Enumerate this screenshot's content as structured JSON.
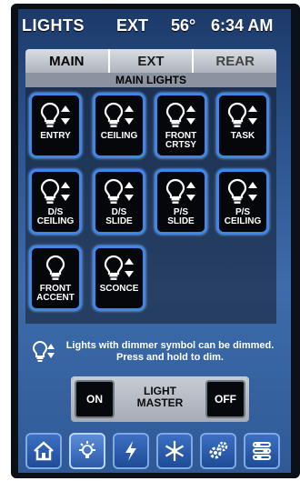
{
  "status": {
    "title": "LIGHTS",
    "ext": "EXT",
    "temp": "56°",
    "time": "6:34 AM"
  },
  "tabs": [
    "MAIN",
    "EXT",
    "REAR"
  ],
  "section_title": "MAIN LIGHTS",
  "lights": [
    {
      "label": "ENTRY",
      "icon": "dimmable-bulb-icon"
    },
    {
      "label": "CEILING",
      "icon": "dimmable-bulb-icon"
    },
    {
      "label": "FRONT\nCRTSY",
      "icon": "dimmable-bulb-icon"
    },
    {
      "label": "TASK",
      "icon": "dimmable-bulb-icon"
    },
    {
      "label": "D/S\nCEILING",
      "icon": "dimmable-bulb-icon"
    },
    {
      "label": "D/S\nSLIDE",
      "icon": "dimmable-bulb-icon"
    },
    {
      "label": "P/S\nSLIDE",
      "icon": "dimmable-bulb-icon"
    },
    {
      "label": "P/S\nCEILING",
      "icon": "dimmable-bulb-icon"
    },
    {
      "label": "FRONT\nACCENT",
      "icon": "bulb-icon"
    },
    {
      "label": "SCONCE",
      "icon": "dimmable-bulb-icon"
    }
  ],
  "info_text": "Lights with dimmer symbol can be dimmed. Press and hold to dim.",
  "master": {
    "on_label": "ON",
    "label": "LIGHT\nMASTER",
    "off_label": "OFF"
  },
  "nav": [
    {
      "icon": "home-icon"
    },
    {
      "icon": "light-bulb-icon"
    },
    {
      "icon": "lightning-icon"
    },
    {
      "icon": "snowflake-icon"
    },
    {
      "icon": "gear-icon"
    },
    {
      "icon": "sliders-icon"
    }
  ],
  "colors": {
    "button_border": "#3e86e8",
    "nav_bg": "#2d5ba8"
  }
}
